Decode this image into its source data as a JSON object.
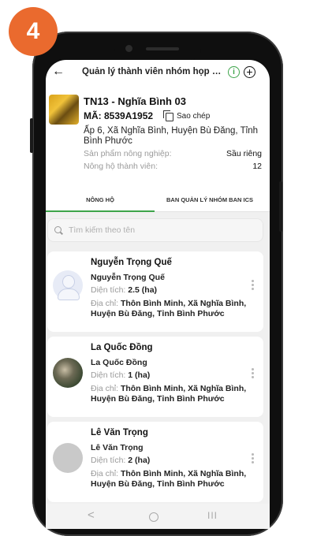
{
  "step_badge": "4",
  "header": {
    "back_icon": "arrow-left-icon",
    "title": "Quản lý thành viên nhóm họp t...",
    "info_icon": "info-circle-icon",
    "add_icon": "add-circle-icon"
  },
  "group": {
    "name": "TN13 - Nghĩa Bình 03",
    "code": "MÃ: 8539A1952",
    "copy_label": "Sao chép",
    "address": "Ấp 6, Xã Nghĩa Bình, Huyện Bù Đăng, Tỉnh Bình Phước",
    "product_label": "Sản phẩm nông nghiệp:",
    "product_value": "Sầu riêng",
    "members_label": "Nông hộ thành viên:",
    "members_value": "12"
  },
  "tabs": [
    {
      "label": "NÔNG HỘ",
      "active": true
    },
    {
      "label": "BAN QUẢN LÝ NHÓM BAN ICS",
      "active": false
    }
  ],
  "search": {
    "placeholder": "Tìm kiếm theo tên"
  },
  "members": [
    {
      "title": "Nguyễn Trọng Quế",
      "name": "Nguyễn Trọng Quế",
      "area_label": "Diện tích:",
      "area_value": "2.5 (ha)",
      "address_label": "Địa chỉ:",
      "address": "Thôn Bình Minh, Xã Nghĩa Bình, Huyện Bù Đăng, Tỉnh Bình Phước",
      "avatar": "default-user-avatar"
    },
    {
      "title": "La Quốc Đồng",
      "name": "La Quốc Đồng",
      "area_label": "Diện tích:",
      "area_value": "1 (ha)",
      "address_label": "Địa chỉ:",
      "address": "Thôn Bình Minh, Xã Nghĩa Bình, Huyện Bù Đăng, Tỉnh Bình Phước",
      "avatar": "photo-avatar"
    },
    {
      "title": "Lê Văn Trọng",
      "name": "Lê Văn Trọng",
      "area_label": "Diện tích:",
      "area_value": "2 (ha)",
      "address_label": "Địa chỉ:",
      "address": "Thôn Bình Minh, Xã Nghĩa Bình, Huyện Bù Đăng, Tỉnh Bình Phước",
      "avatar": "grey-placeholder-avatar"
    }
  ],
  "navbar": {
    "back_glyph": "<",
    "recent_glyph": "III"
  },
  "colors": {
    "accent_green": "#3da44a",
    "badge_orange": "#ea6a2e"
  }
}
